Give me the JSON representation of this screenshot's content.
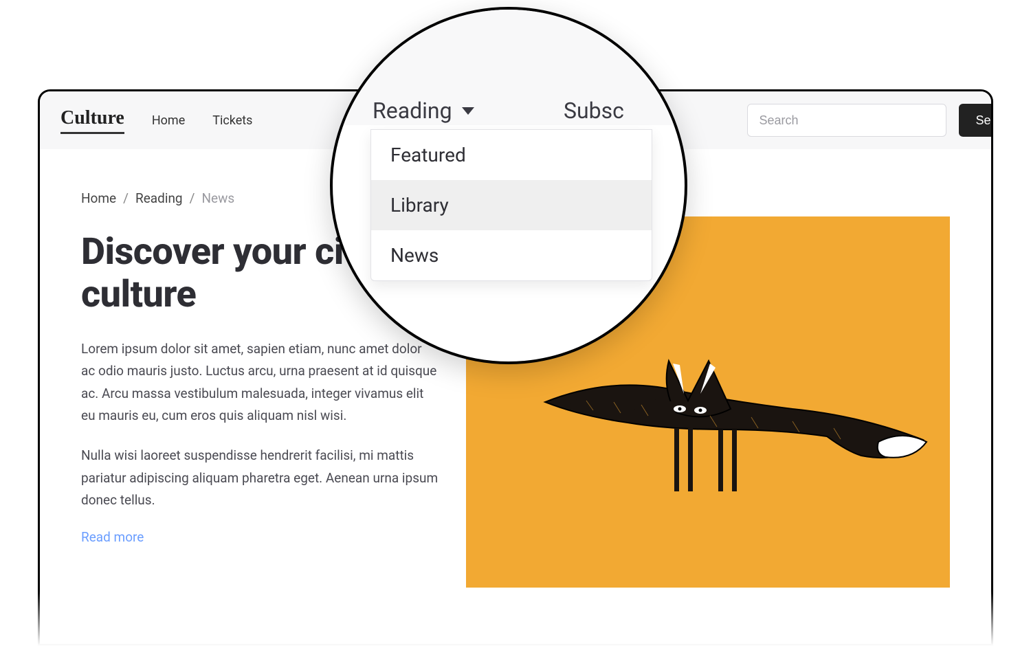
{
  "brand": "Culture",
  "nav": {
    "home": "Home",
    "tickets": "Tickets",
    "reading": "Reading",
    "subscribe_partial": "Subsc"
  },
  "search": {
    "placeholder": "Search",
    "button": "Search"
  },
  "breadcrumb": {
    "home": "Home",
    "reading": "Reading",
    "current": "News",
    "sep": "/"
  },
  "hero": {
    "headline": "Discover your city's culture",
    "p1": "Lorem ipsum dolor sit amet, sapien etiam, nunc amet dolor ac odio mauris justo. Luctus arcu, urna praesent at id quisque ac. Arcu massa vestibulum malesuada, integer vivamus elit eu mauris eu, cum eros quis aliquam nisl wisi.",
    "p2": "Nulla wisi laoreet suspendisse hendrerit facilisi, mi mattis pariatur adipiscing aliquam pharetra eget. Aenean urna ipsum donec tellus.",
    "read_more": "Read more"
  },
  "dropdown": {
    "items": [
      "Featured",
      "Library",
      "News"
    ],
    "hover_index": 1
  },
  "colors": {
    "accent": "#f2a933",
    "link": "#6b9eff"
  }
}
